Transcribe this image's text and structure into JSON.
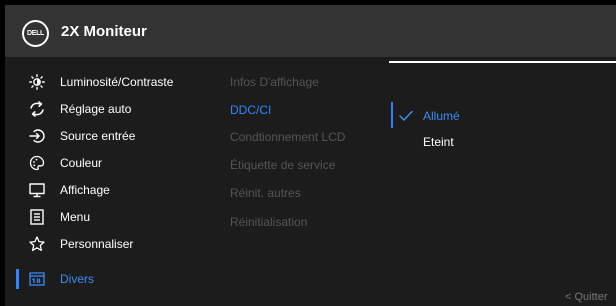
{
  "header": {
    "logo_text": "DELL",
    "title": "2X Moniteur"
  },
  "menu": [
    {
      "label": "Luminosité/Contraste",
      "icon": "brightness-icon"
    },
    {
      "label": "Réglage auto",
      "icon": "auto-adjust-icon"
    },
    {
      "label": "Source entrée",
      "icon": "input-source-icon"
    },
    {
      "label": "Couleur",
      "icon": "palette-icon"
    },
    {
      "label": "Affichage",
      "icon": "display-icon"
    },
    {
      "label": "Menu",
      "icon": "menu-icon"
    },
    {
      "label": "Personnaliser",
      "icon": "star-icon"
    },
    {
      "label": "Divers",
      "icon": "others-icon",
      "active": true
    }
  ],
  "submenu": [
    {
      "label": "Infos D'affichage"
    },
    {
      "label": "DDC/CI",
      "active": true
    },
    {
      "label": "Condtionnement LCD"
    },
    {
      "label": "Étiquette de service"
    },
    {
      "label": "Réinit. autres"
    },
    {
      "label": "Réinitialisation"
    }
  ],
  "options": [
    {
      "label": "Allumé",
      "selected": true
    },
    {
      "label": "Eteint",
      "selected": false
    }
  ],
  "footer": {
    "quit": "< Quitter"
  },
  "colors": {
    "accent": "#2f85ff",
    "header_bg": "#333333",
    "panel_bg": "#1c1c1c",
    "disabled_text": "#555555"
  }
}
